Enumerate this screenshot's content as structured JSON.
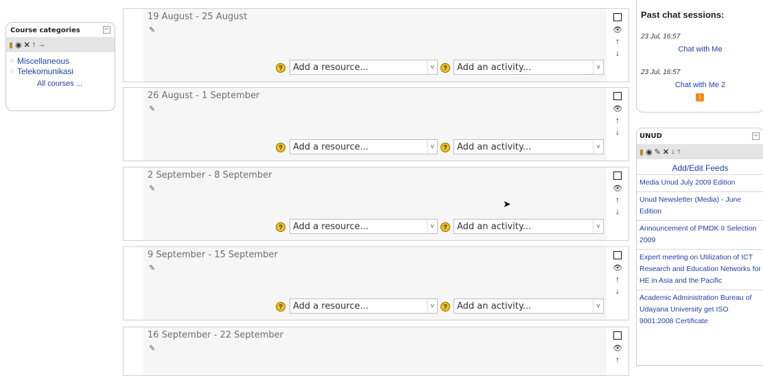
{
  "course_categories": {
    "title": "Course categories",
    "collapse": "−",
    "edit_icons": [
      "pencil-icon",
      "eye-icon",
      "delete-icon",
      "move-up-icon",
      "move-icon"
    ],
    "items": [
      {
        "label": "Miscellaneous"
      },
      {
        "label": "Telekomunikasi"
      }
    ],
    "all_courses": "All courses ..."
  },
  "weeks": [
    {
      "title": "19 August - 25 August",
      "resource_placeholder": "Add a resource...",
      "activity_placeholder": "Add an activity..."
    },
    {
      "title": "26 August - 1 September",
      "resource_placeholder": "Add a resource...",
      "activity_placeholder": "Add an activity..."
    },
    {
      "title": "2 September - 8 September",
      "resource_placeholder": "Add a resource...",
      "activity_placeholder": "Add an activity..."
    },
    {
      "title": "9 September - 15 September",
      "resource_placeholder": "Add a resource...",
      "activity_placeholder": "Add an activity..."
    },
    {
      "title": "16 September - 22 September",
      "resource_placeholder": "Add a resource...",
      "activity_placeholder": "Add an activity..."
    }
  ],
  "icons": {
    "help": "?",
    "edit_summary": "✎",
    "eye": "👁",
    "up": "↑",
    "down": "↓",
    "select_arrow": "v",
    "rss": "RSS"
  },
  "chat": {
    "title": "Past chat sessions:",
    "sessions": [
      {
        "date": "23 Jul, 16:57",
        "link": "Chat with Me"
      },
      {
        "date": "23 Jul, 16:57",
        "link": "Chat with Me 2"
      }
    ]
  },
  "unud": {
    "title": "UNUD",
    "collapse": "−",
    "feeds_link": "Add/Edit Feeds",
    "items": [
      "Media Unud July 2009 Edition",
      "Unud Newsletter (Media) - June Edition",
      "Announcement of PMDK II Selection 2009",
      "Expert meeting on Utilization of ICT Research and Education Networks for HE in Asia and the Pacific",
      "Academic Administration Bureau of Udayana University get ISO 9001:2008 Certificate"
    ]
  },
  "colors": {
    "link": "#1f3ea8",
    "week_bg": "#f6f6f6",
    "strip": "#e4e4e4"
  }
}
